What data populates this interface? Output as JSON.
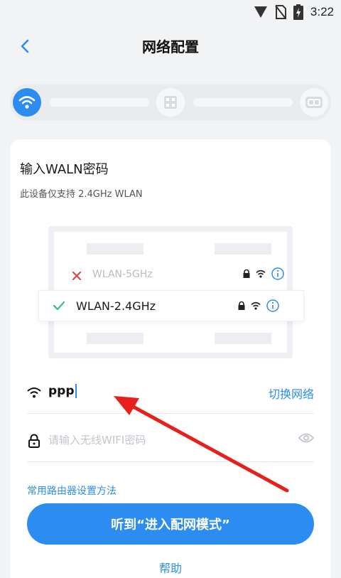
{
  "status_bar": {
    "time": "3:22"
  },
  "header": {
    "title": "网络配置"
  },
  "progress": {
    "steps": [
      "wifi-icon",
      "grid-icon",
      "link-icon"
    ],
    "active_step": 1
  },
  "card": {
    "title": "输入WALN密码",
    "subtitle": "此设备仅支持 2.4GHz WLAN",
    "illustration": {
      "wlan5": "WLAN-5GHz",
      "wlan24": "WLAN-2.4GHz"
    },
    "wifi_name": "ppp",
    "switch_network": "切换网络",
    "password_placeholder": "请输入无线WIFI密码",
    "router_link": "常用路由器设置方法",
    "primary_button": "听到“进入配网模式”",
    "help": "帮助"
  },
  "colors": {
    "accent": "#2d8cf0",
    "annotation": "#e8201c"
  }
}
